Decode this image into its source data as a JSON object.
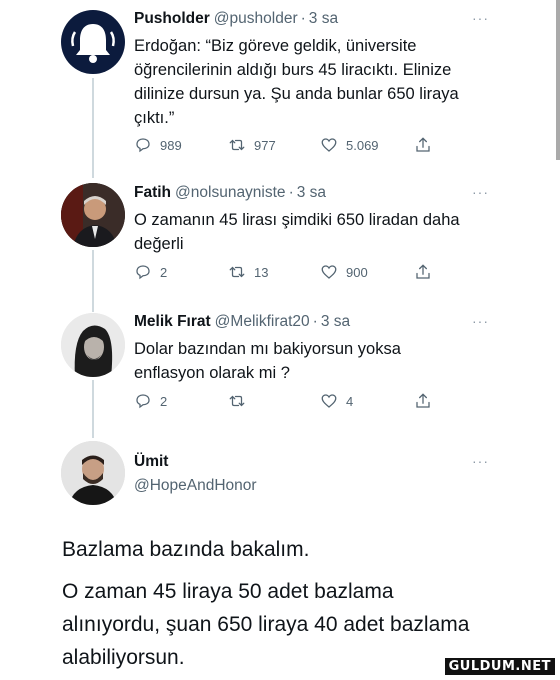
{
  "tweets": [
    {
      "name": "Pusholder",
      "handle": "@pusholder",
      "time": "3 sa",
      "more": "···",
      "text": "Erdoğan: “Biz göreve geldik, üniversite öğrencilerinin aldığı burs 45 liracıktı. Elinize dilinize dursun ya. Şu anda bunlar 650 liraya çıktı.”",
      "replies": "989",
      "retweets": "977",
      "likes": "5.069"
    },
    {
      "name": "Fatih",
      "handle": "@nolsunayniste",
      "time": "3 sa",
      "more": "···",
      "text": "O zamanın 45 lirası şimdiki 650 liradan daha değerli",
      "replies": "2",
      "retweets": "13",
      "likes": "900"
    },
    {
      "name": "Melik Fırat",
      "handle": "@Melikfirat20",
      "time": "3 sa",
      "more": "···",
      "text": "Dolar bazından mı bakiyorsun yoksa enflasyon olarak mi ?",
      "replies": "2",
      "retweets": "",
      "likes": "4"
    }
  ],
  "main_tweet": {
    "name": "Ümit",
    "handle": "@HopeAndHonor",
    "more": "···",
    "line1": "Bazlama bazında bakalım.",
    "line2": "O zaman 45 liraya 50 adet bazlama alınıyordu, şuan 650 liraya 40 adet bazlama alabiliyorsun."
  },
  "watermark": "GULDUM.NET",
  "icons": [
    "bell-icon",
    "reply-icon",
    "retweet-icon",
    "like-icon",
    "share-icon"
  ],
  "colors": {
    "pusholder_avatar": "#0c1b3d",
    "text": "#0f1419",
    "muted": "#536471",
    "thread_line": "#cfd9de"
  }
}
